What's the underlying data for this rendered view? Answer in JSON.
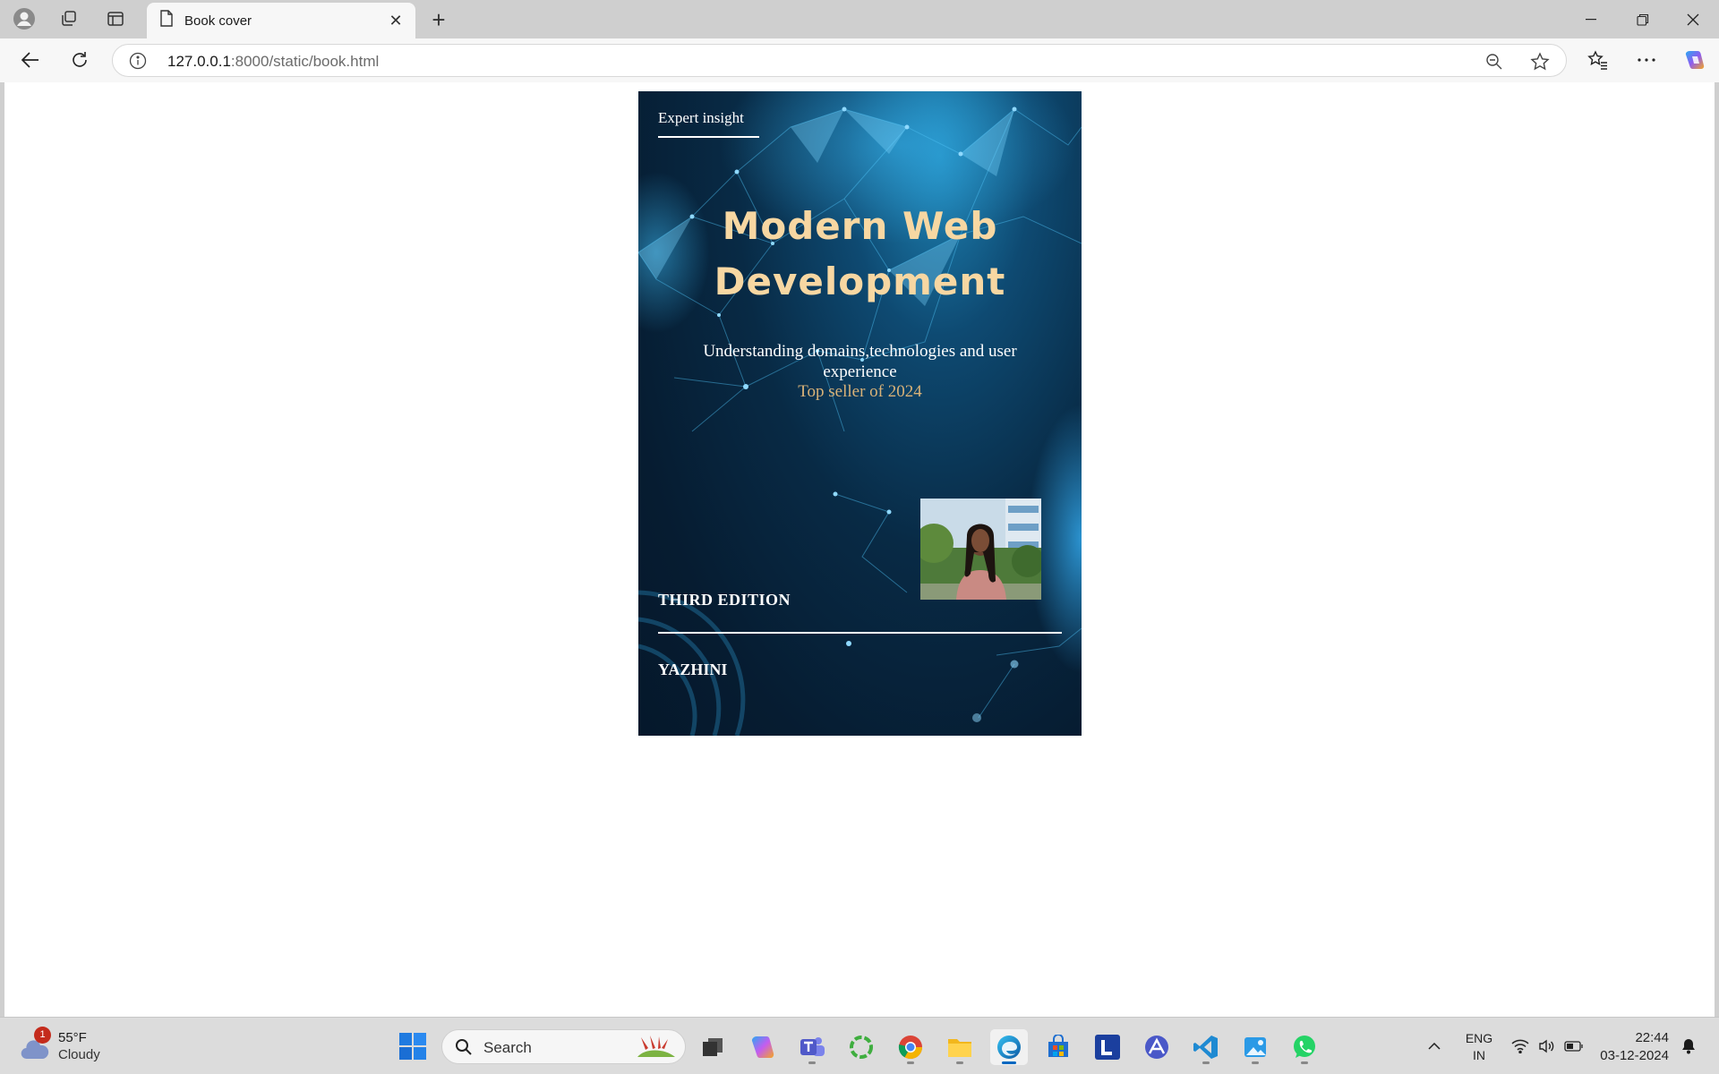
{
  "browser": {
    "tab": {
      "title": "Book cover"
    },
    "address_bar": {
      "host": "127.0.0.1",
      "path": ":8000/static/book.html"
    }
  },
  "book": {
    "tag": "Expert insight",
    "title_line1": "Modern Web",
    "title_line2": "Development",
    "subtitle": "Understanding domains,technologies and user experience",
    "badge": "Top seller of 2024",
    "edition": "THIRD EDITION",
    "author": "YAZHINI"
  },
  "taskbar": {
    "weather": {
      "temp": "55°F",
      "condition": "Cloudy",
      "badge": "1"
    },
    "search_label": "Search",
    "language": {
      "line1": "ENG",
      "line2": "IN"
    },
    "clock": {
      "time": "22:44",
      "date": "03-12-2024"
    },
    "apps": [
      "file-explorer-tray",
      "copilot",
      "teams",
      "circle-app",
      "chrome",
      "file-explorer",
      "edge",
      "microsoft-store",
      "l-app",
      "arc-app",
      "vscode",
      "photos",
      "whatsapp"
    ]
  },
  "colors": {
    "title": "#f7d7a2",
    "badge": "#d9b278",
    "cover_bg": "#061c31",
    "accent": "#0067c0"
  }
}
